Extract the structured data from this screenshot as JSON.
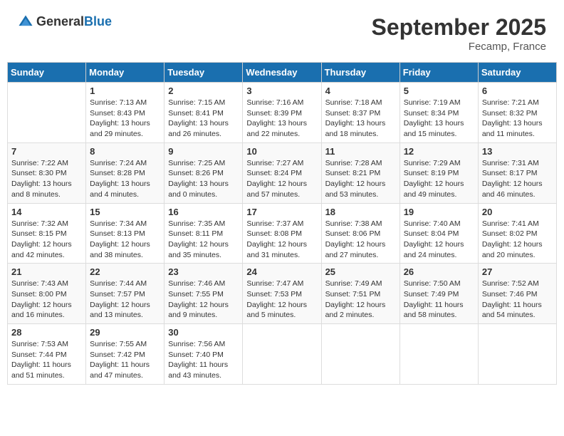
{
  "header": {
    "logo_general": "General",
    "logo_blue": "Blue",
    "month": "September 2025",
    "location": "Fecamp, France"
  },
  "columns": [
    "Sunday",
    "Monday",
    "Tuesday",
    "Wednesday",
    "Thursday",
    "Friday",
    "Saturday"
  ],
  "weeks": [
    [
      {
        "day": "",
        "info": ""
      },
      {
        "day": "1",
        "info": "Sunrise: 7:13 AM\nSunset: 8:43 PM\nDaylight: 13 hours and 29 minutes."
      },
      {
        "day": "2",
        "info": "Sunrise: 7:15 AM\nSunset: 8:41 PM\nDaylight: 13 hours and 26 minutes."
      },
      {
        "day": "3",
        "info": "Sunrise: 7:16 AM\nSunset: 8:39 PM\nDaylight: 13 hours and 22 minutes."
      },
      {
        "day": "4",
        "info": "Sunrise: 7:18 AM\nSunset: 8:37 PM\nDaylight: 13 hours and 18 minutes."
      },
      {
        "day": "5",
        "info": "Sunrise: 7:19 AM\nSunset: 8:34 PM\nDaylight: 13 hours and 15 minutes."
      },
      {
        "day": "6",
        "info": "Sunrise: 7:21 AM\nSunset: 8:32 PM\nDaylight: 13 hours and 11 minutes."
      }
    ],
    [
      {
        "day": "7",
        "info": "Sunrise: 7:22 AM\nSunset: 8:30 PM\nDaylight: 13 hours and 8 minutes."
      },
      {
        "day": "8",
        "info": "Sunrise: 7:24 AM\nSunset: 8:28 PM\nDaylight: 13 hours and 4 minutes."
      },
      {
        "day": "9",
        "info": "Sunrise: 7:25 AM\nSunset: 8:26 PM\nDaylight: 13 hours and 0 minutes."
      },
      {
        "day": "10",
        "info": "Sunrise: 7:27 AM\nSunset: 8:24 PM\nDaylight: 12 hours and 57 minutes."
      },
      {
        "day": "11",
        "info": "Sunrise: 7:28 AM\nSunset: 8:21 PM\nDaylight: 12 hours and 53 minutes."
      },
      {
        "day": "12",
        "info": "Sunrise: 7:29 AM\nSunset: 8:19 PM\nDaylight: 12 hours and 49 minutes."
      },
      {
        "day": "13",
        "info": "Sunrise: 7:31 AM\nSunset: 8:17 PM\nDaylight: 12 hours and 46 minutes."
      }
    ],
    [
      {
        "day": "14",
        "info": "Sunrise: 7:32 AM\nSunset: 8:15 PM\nDaylight: 12 hours and 42 minutes."
      },
      {
        "day": "15",
        "info": "Sunrise: 7:34 AM\nSunset: 8:13 PM\nDaylight: 12 hours and 38 minutes."
      },
      {
        "day": "16",
        "info": "Sunrise: 7:35 AM\nSunset: 8:11 PM\nDaylight: 12 hours and 35 minutes."
      },
      {
        "day": "17",
        "info": "Sunrise: 7:37 AM\nSunset: 8:08 PM\nDaylight: 12 hours and 31 minutes."
      },
      {
        "day": "18",
        "info": "Sunrise: 7:38 AM\nSunset: 8:06 PM\nDaylight: 12 hours and 27 minutes."
      },
      {
        "day": "19",
        "info": "Sunrise: 7:40 AM\nSunset: 8:04 PM\nDaylight: 12 hours and 24 minutes."
      },
      {
        "day": "20",
        "info": "Sunrise: 7:41 AM\nSunset: 8:02 PM\nDaylight: 12 hours and 20 minutes."
      }
    ],
    [
      {
        "day": "21",
        "info": "Sunrise: 7:43 AM\nSunset: 8:00 PM\nDaylight: 12 hours and 16 minutes."
      },
      {
        "day": "22",
        "info": "Sunrise: 7:44 AM\nSunset: 7:57 PM\nDaylight: 12 hours and 13 minutes."
      },
      {
        "day": "23",
        "info": "Sunrise: 7:46 AM\nSunset: 7:55 PM\nDaylight: 12 hours and 9 minutes."
      },
      {
        "day": "24",
        "info": "Sunrise: 7:47 AM\nSunset: 7:53 PM\nDaylight: 12 hours and 5 minutes."
      },
      {
        "day": "25",
        "info": "Sunrise: 7:49 AM\nSunset: 7:51 PM\nDaylight: 12 hours and 2 minutes."
      },
      {
        "day": "26",
        "info": "Sunrise: 7:50 AM\nSunset: 7:49 PM\nDaylight: 11 hours and 58 minutes."
      },
      {
        "day": "27",
        "info": "Sunrise: 7:52 AM\nSunset: 7:46 PM\nDaylight: 11 hours and 54 minutes."
      }
    ],
    [
      {
        "day": "28",
        "info": "Sunrise: 7:53 AM\nSunset: 7:44 PM\nDaylight: 11 hours and 51 minutes."
      },
      {
        "day": "29",
        "info": "Sunrise: 7:55 AM\nSunset: 7:42 PM\nDaylight: 11 hours and 47 minutes."
      },
      {
        "day": "30",
        "info": "Sunrise: 7:56 AM\nSunset: 7:40 PM\nDaylight: 11 hours and 43 minutes."
      },
      {
        "day": "",
        "info": ""
      },
      {
        "day": "",
        "info": ""
      },
      {
        "day": "",
        "info": ""
      },
      {
        "day": "",
        "info": ""
      }
    ]
  ]
}
